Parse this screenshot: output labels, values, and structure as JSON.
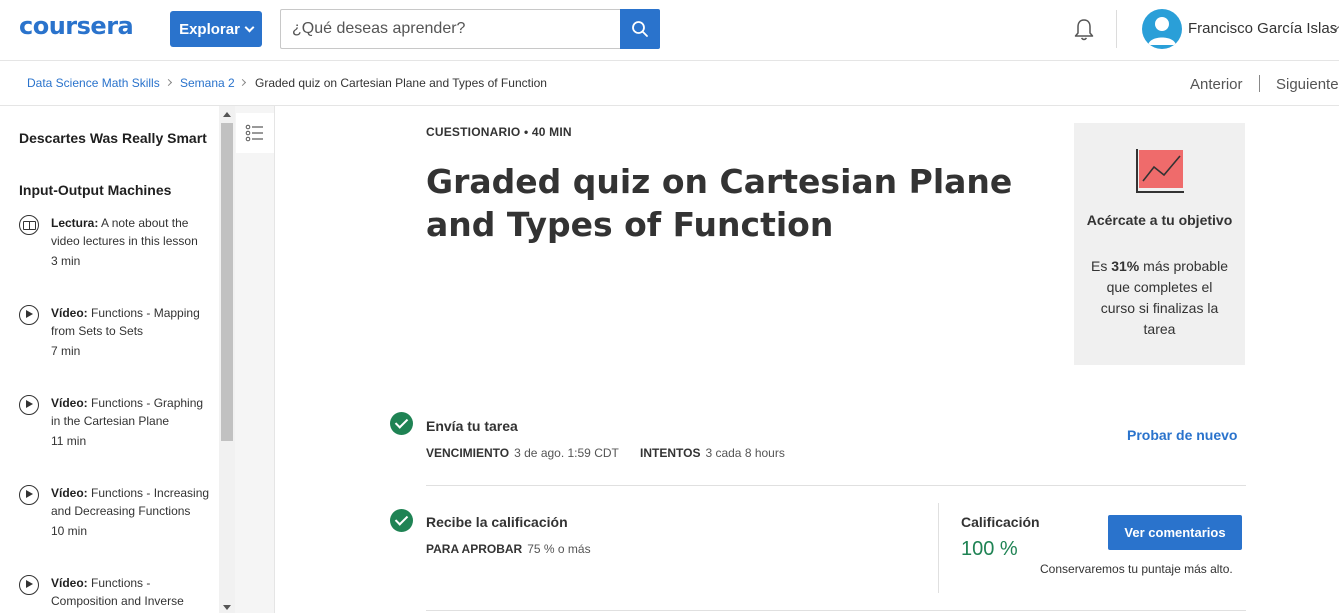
{
  "header": {
    "logo": "coursera",
    "explore_label": "Explorar",
    "search_placeholder": "¿Qué deseas aprender?",
    "user_name": "Francisco García Islas"
  },
  "breadcrumb": {
    "items": [
      "Data Science Math Skills",
      "Semana 2",
      "Graded quiz on Cartesian Plane and Types of Function"
    ],
    "prev": "Anterior",
    "next": "Siguiente"
  },
  "sidebar": {
    "headings": [
      "Descartes Was Really Smart",
      "Input-Output Machines"
    ],
    "items": [
      {
        "kind": "Lectura:",
        "text": "A note about the video lectures in this lesson",
        "duration": "3 min",
        "icon": "book-icon"
      },
      {
        "kind": "Vídeo:",
        "text": "Functions - Mapping from Sets to Sets",
        "duration": "7 min",
        "icon": "play-icon"
      },
      {
        "kind": "Vídeo:",
        "text": "Functions - Graphing in the Cartesian Plane",
        "duration": "11 min",
        "icon": "play-icon"
      },
      {
        "kind": "Vídeo:",
        "text": "Functions - Increasing and Decreasing Functions",
        "duration": "10 min",
        "icon": "play-icon"
      },
      {
        "kind": "Vídeo:",
        "text": "Functions - Composition and Inverse",
        "duration": "",
        "icon": "play-icon"
      }
    ]
  },
  "main": {
    "kicker": "CUESTIONARIO • 40 MIN",
    "title": "Graded quiz on Cartesian Plane and Types of Function",
    "goal": {
      "title": "Acércate a tu objetivo",
      "body_prefix": "Es",
      "percent": "31%",
      "body_suffix": "más probable que completes el curso si finalizas la tarea"
    },
    "submit": {
      "title": "Envía tu tarea",
      "due_label": "VENCIMIENTO",
      "due_value": "3 de ago. 1:59 CDT",
      "attempts_label": "INTENTOS",
      "attempts_value": "3 cada 8 hours",
      "retry": "Probar de nuevo"
    },
    "grade": {
      "title": "Recibe la calificación",
      "pass_label": "PARA APROBAR",
      "pass_value": "75 % o más",
      "grade_label": "Calificación",
      "grade_value": "100 %",
      "feedback_button": "Ver comentarios",
      "note": "Conservaremos tu puntaje más alto."
    }
  },
  "colors": {
    "brand": "#2a73cc",
    "success": "#1f8354",
    "goal_chart": "#ef6b6b"
  }
}
